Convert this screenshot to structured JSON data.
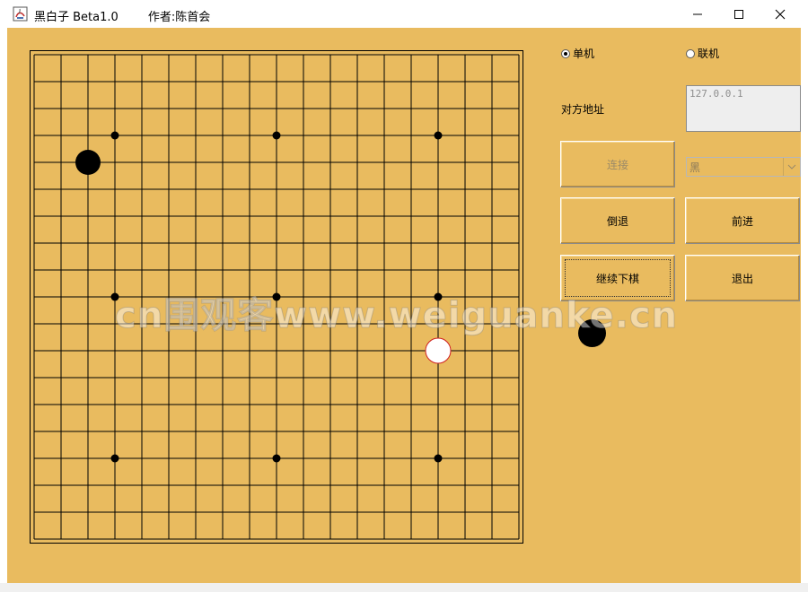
{
  "window": {
    "title": "黑白子 Beta1.0        作者:陈首会"
  },
  "mode": {
    "single_label": "单机",
    "network_label": "联机",
    "selected": "single"
  },
  "address": {
    "label": "对方地址",
    "value": "127.0.0.1"
  },
  "buttons": {
    "connect": "连接",
    "undo": "倒退",
    "forward": "前进",
    "continue": "继续下棋",
    "exit": "退出"
  },
  "color_select": {
    "value": "黑"
  },
  "board": {
    "lines": 19,
    "star_points": [
      [
        3,
        3
      ],
      [
        3,
        9
      ],
      [
        3,
        15
      ],
      [
        9,
        3
      ],
      [
        9,
        9
      ],
      [
        9,
        15
      ],
      [
        15,
        3
      ],
      [
        15,
        9
      ],
      [
        15,
        15
      ]
    ],
    "stones": [
      {
        "row": 4,
        "col": 2,
        "color": "black"
      },
      {
        "row": 11,
        "col": 15,
        "color": "white",
        "last_move": true
      }
    ]
  },
  "turn_indicator": "black",
  "watermark": "cn围观客www.weiguanke.cn",
  "colors": {
    "background": "#e9bb5f",
    "last_move_ring": "#d02020"
  }
}
